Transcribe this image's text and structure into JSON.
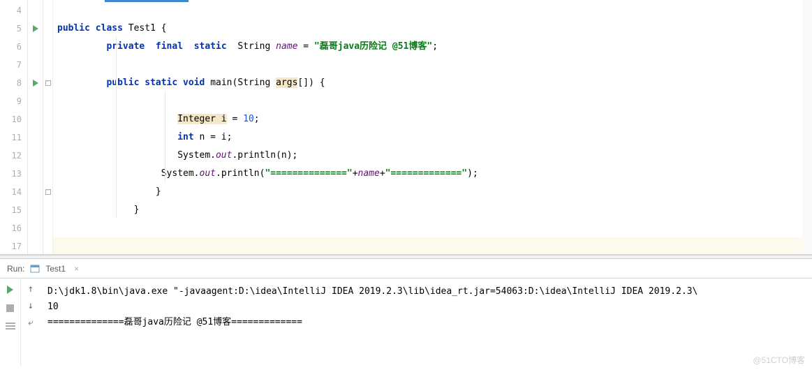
{
  "editor": {
    "lineNumbers": [
      "4",
      "5",
      "6",
      "7",
      "8",
      "9",
      "10",
      "11",
      "12",
      "13",
      "14",
      "15",
      "16",
      "17"
    ],
    "code": {
      "l5_public": "public",
      "l5_class": "class",
      "l5_name": "Test1 {",
      "l6_private": "private",
      "l6_final": "final",
      "l6_static": "static",
      "l6_type": "String",
      "l6_field": "name",
      "l6_eq": " = ",
      "l6_str": "\"磊哥java历险记 @51博客\"",
      "l6_semi": ";",
      "l8_public": "public",
      "l8_static": "static",
      "l8_void": "void",
      "l8_main": "main(String ",
      "l8_args": "args",
      "l8_rest": "[]) {",
      "l10_type": "Integer",
      "l10_var": " i",
      "l10_rest": " = ",
      "l10_num": "10",
      "l10_semi": ";",
      "l11_int": "int",
      "l11_rest": " n = i;",
      "l12": "System.",
      "l12_out": "out",
      "l12_rest": ".println(n);",
      "l13": "System.",
      "l13_out": "out",
      "l13_print": ".println(",
      "l13_str1": "\"==============\"",
      "l13_plus1": "+",
      "l13_name": "name",
      "l13_plus2": "+",
      "l13_str2": "\"=============\"",
      "l13_end": ");",
      "l14": "}",
      "l15": "}"
    }
  },
  "runPanel": {
    "label": "Run:",
    "tabName": "Test1",
    "output": {
      "line1": "D:\\jdk1.8\\bin\\java.exe \"-javaagent:D:\\idea\\IntelliJ IDEA 2019.2.3\\lib\\idea_rt.jar=54063:D:\\idea\\IntelliJ IDEA 2019.2.3\\",
      "line2": "10",
      "line3": "==============磊哥java历险记 @51博客============="
    }
  },
  "watermark": "@51CTO博客"
}
